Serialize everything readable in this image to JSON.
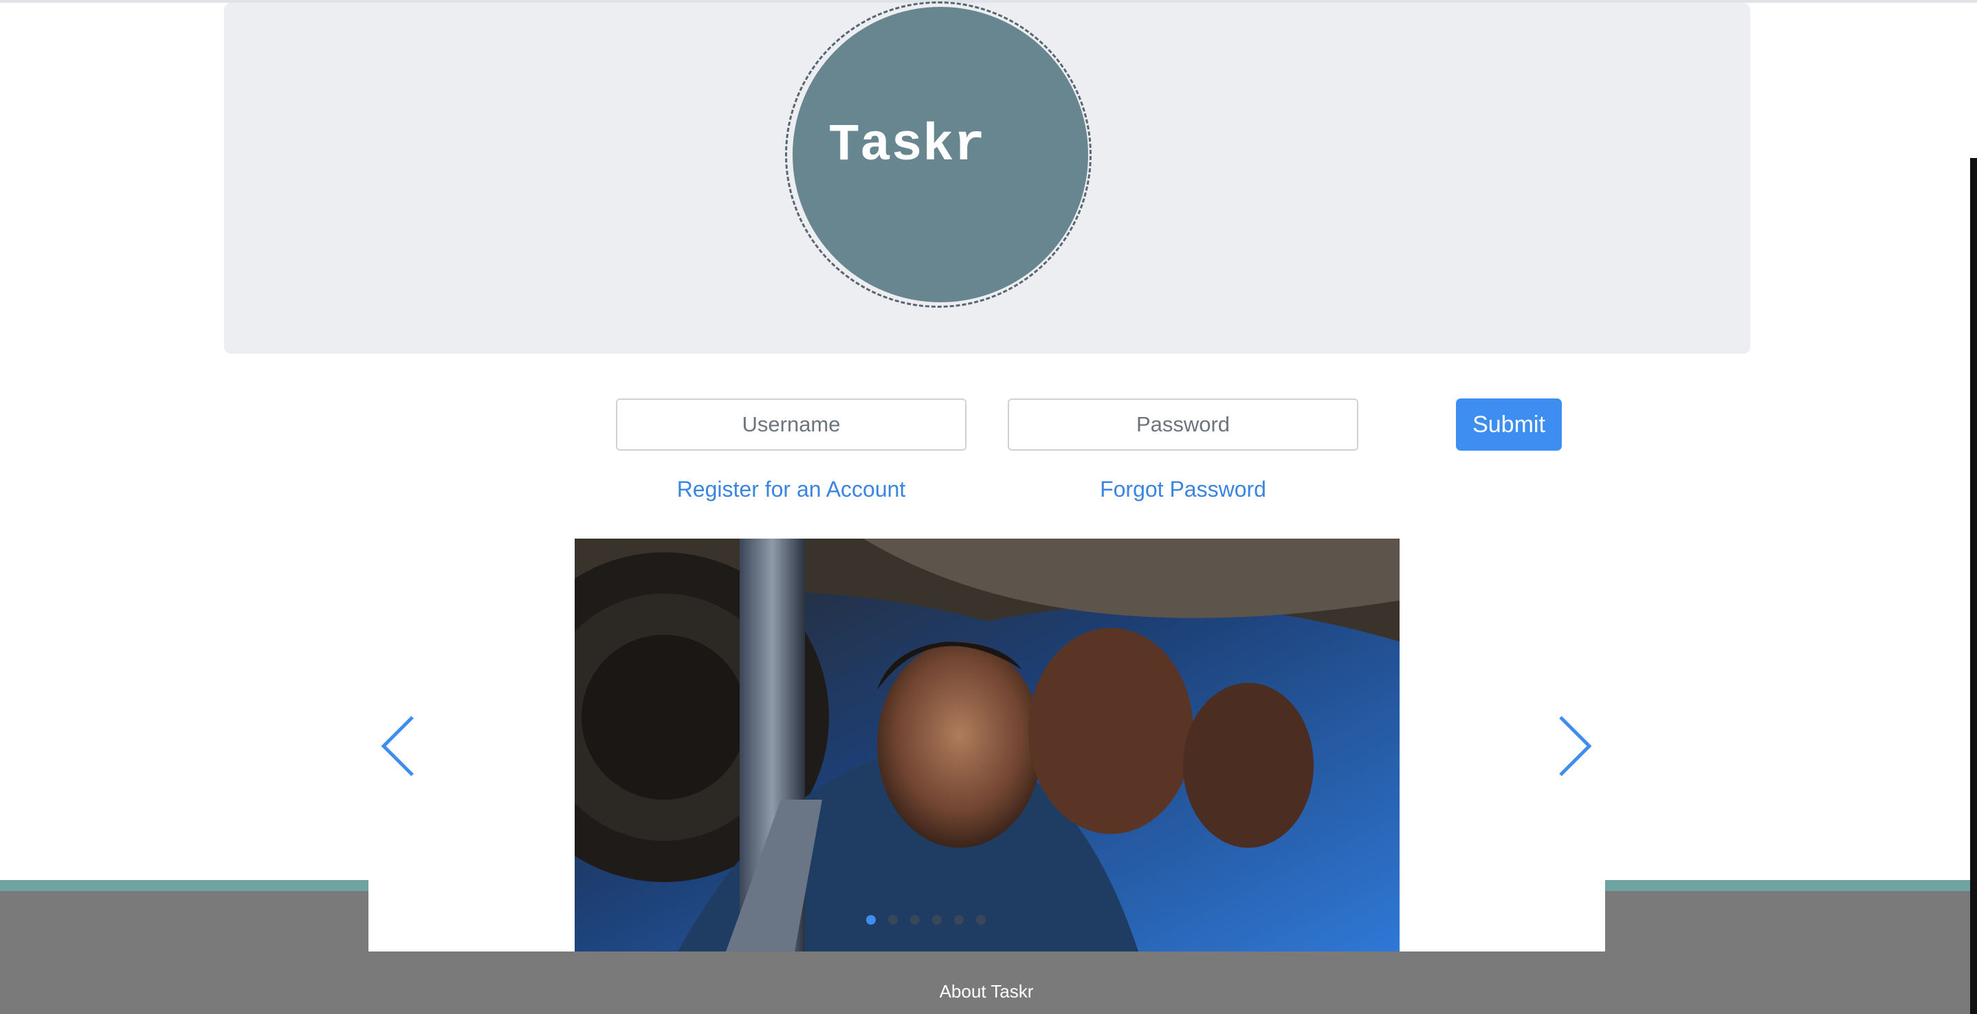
{
  "brand": {
    "logo_text": "Taskr"
  },
  "login": {
    "username_placeholder": "Username",
    "password_placeholder": "Password",
    "submit_label": "Submit",
    "register_link": "Register for an Account",
    "forgot_link": "Forgot Password"
  },
  "carousel": {
    "slide_count": 6,
    "active_index": 0,
    "prev_icon": "chevron-left-icon",
    "next_icon": "chevron-right-icon"
  },
  "footer": {
    "about_link": "About Taskr"
  },
  "colors": {
    "accent": "#3e8ef2",
    "link": "#3a85e0",
    "logo_circle": "#688690",
    "footer": "#7a7a7a",
    "teal_strip": "#6fa3a1"
  }
}
